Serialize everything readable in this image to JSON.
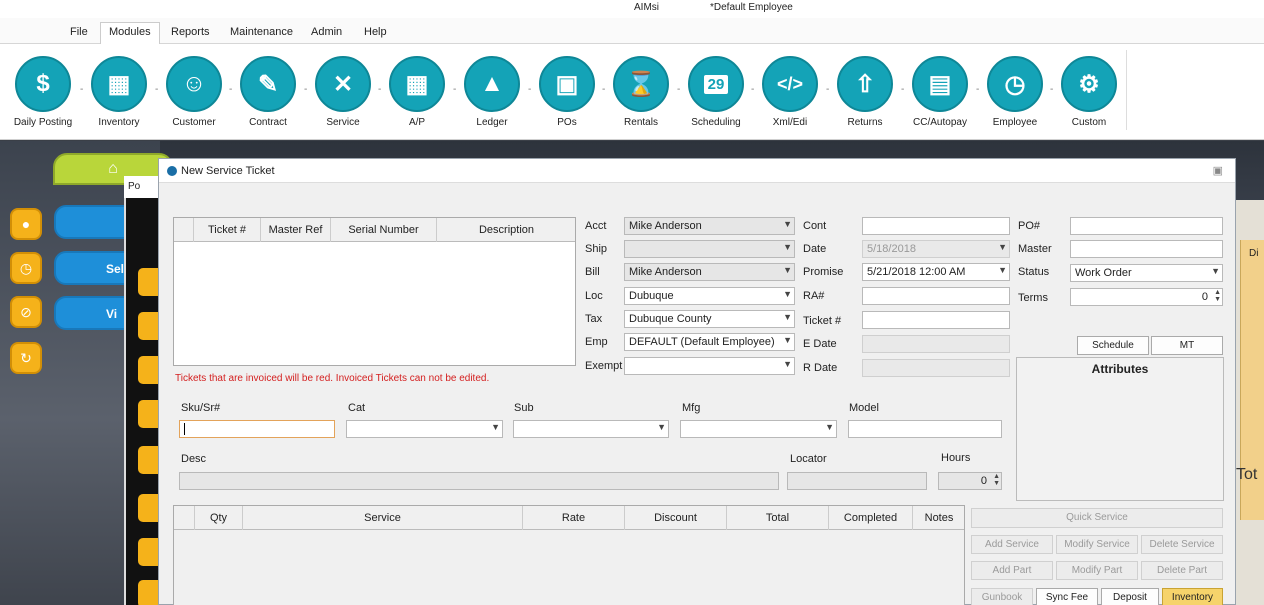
{
  "titlebar": {
    "app": "AIMsi",
    "user": "*Default Employee"
  },
  "menu": [
    "File",
    "Modules",
    "Reports",
    "Maintenance",
    "Admin",
    "Help"
  ],
  "menu_active": "Modules",
  "modules": [
    {
      "label": "Daily Posting",
      "icon": "dollar-icon"
    },
    {
      "label": "Inventory",
      "icon": "barcode-icon"
    },
    {
      "label": "Customer",
      "icon": "people-icon"
    },
    {
      "label": "Contract",
      "icon": "pencil-icon"
    },
    {
      "label": "Service",
      "icon": "wrench-screwdriver-icon"
    },
    {
      "label": "A/P",
      "icon": "calculator-icon"
    },
    {
      "label": "Ledger",
      "icon": "bar-chart-icon"
    },
    {
      "label": "POs",
      "icon": "box-icon"
    },
    {
      "label": "Rentals",
      "icon": "hourglass-icon"
    },
    {
      "label": "Scheduling",
      "icon": "calendar-icon"
    },
    {
      "label": "Xml/Edi",
      "icon": "code-icon"
    },
    {
      "label": "Returns",
      "icon": "return-box-icon"
    },
    {
      "label": "CC/Autopay",
      "icon": "credit-card-icon"
    },
    {
      "label": "Employee",
      "icon": "clock-icon"
    },
    {
      "label": "Custom",
      "icon": "gear-icon"
    }
  ],
  "calendar_day": "29",
  "background": {
    "pills": [
      "Sel",
      "Vi"
    ],
    "pos_title": "Po",
    "right_label": "Tot",
    "right_header": "Di"
  },
  "dialog": {
    "title": "New Service Ticket",
    "ticket_columns": [
      "Ticket #",
      "Master Ref",
      "Serial Number",
      "Description"
    ],
    "note": "Tickets that are invoiced will be red. Invoiced Tickets can not be edited.",
    "labels": {
      "acct": "Acct",
      "ship": "Ship",
      "bill": "Bill",
      "loc": "Loc",
      "tax": "Tax",
      "emp": "Emp",
      "exempt": "Exempt",
      "cont": "Cont",
      "date": "Date",
      "promise": "Promise",
      "ra": "RA#",
      "ticket": "Ticket #",
      "edate": "E Date",
      "rdate": "R Date",
      "po": "PO#",
      "master": "Master",
      "status": "Status",
      "terms": "Terms",
      "sku": "Sku/Sr#",
      "cat": "Cat",
      "sub": "Sub",
      "mfg": "Mfg",
      "model": "Model",
      "desc": "Desc",
      "locator": "Locator",
      "hours": "Hours"
    },
    "values": {
      "acct": "Mike Anderson",
      "ship": "",
      "bill": "Mike Anderson",
      "loc": "Dubuque",
      "tax": "Dubuque County",
      "emp": "DEFAULT (Default Employee)",
      "exempt": "",
      "cont": "",
      "date": "5/18/2018",
      "promise": "5/21/2018 12:00 AM",
      "ra": "",
      "ticket": "",
      "po": "",
      "master": "",
      "status": "Work Order",
      "terms": "0",
      "hours": "0"
    },
    "buttons": {
      "schedule": "Schedule",
      "mt": "MT",
      "quick_service": "Quick Service",
      "add_service": "Add Service",
      "modify_service": "Modify Service",
      "delete_service": "Delete Service",
      "add_part": "Add Part",
      "modify_part": "Modify Part",
      "delete_part": "Delete Part",
      "gunbook": "Gunbook",
      "sync_fee": "Sync Fee",
      "deposit": "Deposit",
      "inventory": "Inventory"
    },
    "attributes_title": "Attributes",
    "service_columns": [
      "Qty",
      "Service",
      "Rate",
      "Discount",
      "Total",
      "Completed",
      "Notes"
    ]
  },
  "colors": {
    "accent": "#14a3b7",
    "note_red": "#d42020",
    "gold": "#f5b21a",
    "green": "#b9d63a"
  }
}
